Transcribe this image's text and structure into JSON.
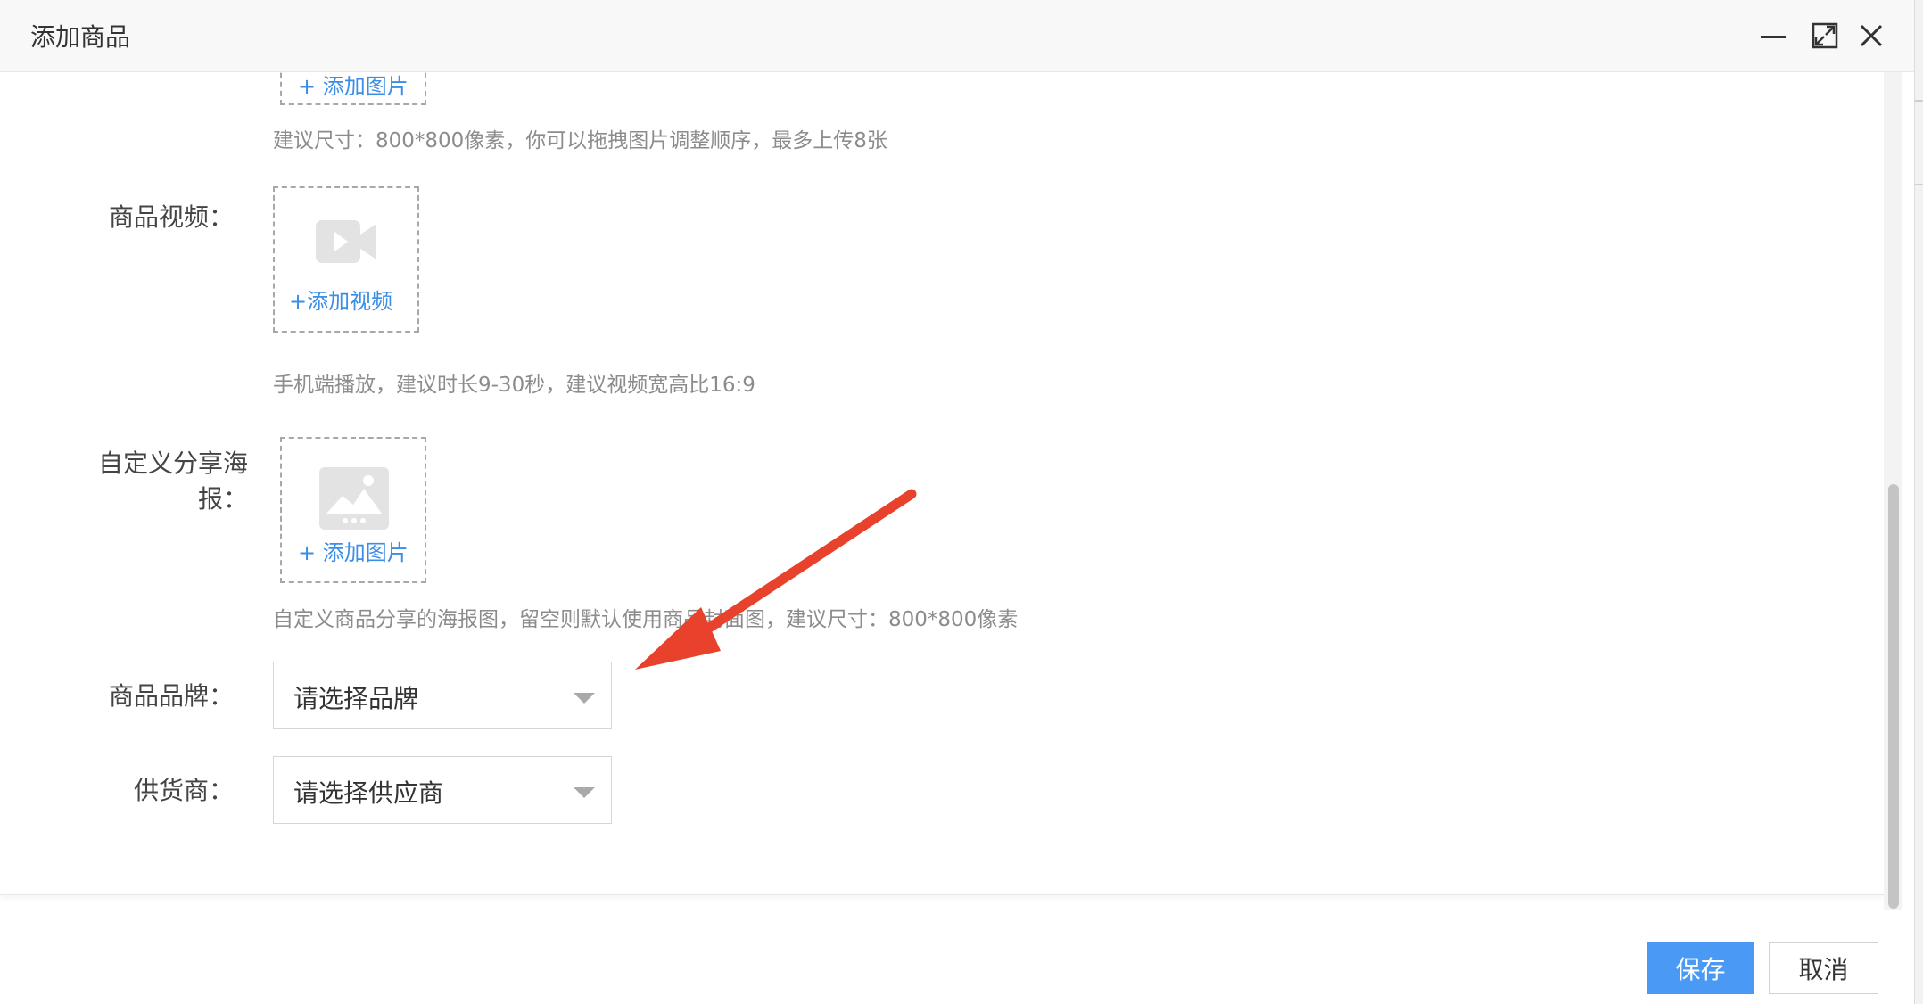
{
  "window": {
    "title": "添加商品",
    "controls": {
      "minimize_icon": "minimize-icon",
      "maximize_icon": "maximize-icon",
      "close_icon": "close-icon"
    }
  },
  "form": {
    "images": {
      "add_label": "+ 添加图片",
      "hint": "建议尺寸：800*800像素，你可以拖拽图片调整顺序，最多上传8张"
    },
    "video": {
      "label": "商品视频：",
      "add_label": "+添加视频",
      "hint": "手机端播放，建议时长9-30秒，建议视频宽高比16:9"
    },
    "poster": {
      "label_line1": "自定义分享海",
      "label_line2": "报：",
      "add_label": "+ 添加图片",
      "hint": "自定义商品分享的海报图，留空则默认使用商品封面图，建议尺寸：800*800像素"
    },
    "brand": {
      "label": "商品品牌：",
      "placeholder": "请选择品牌"
    },
    "supplier": {
      "label": "供货商：",
      "placeholder": "请选择供应商"
    }
  },
  "footer": {
    "save_label": "保存",
    "cancel_label": "取消"
  },
  "colors": {
    "primary": "#4a9af5",
    "link": "#3b8ee8",
    "annotation_arrow": "#e8412c"
  }
}
